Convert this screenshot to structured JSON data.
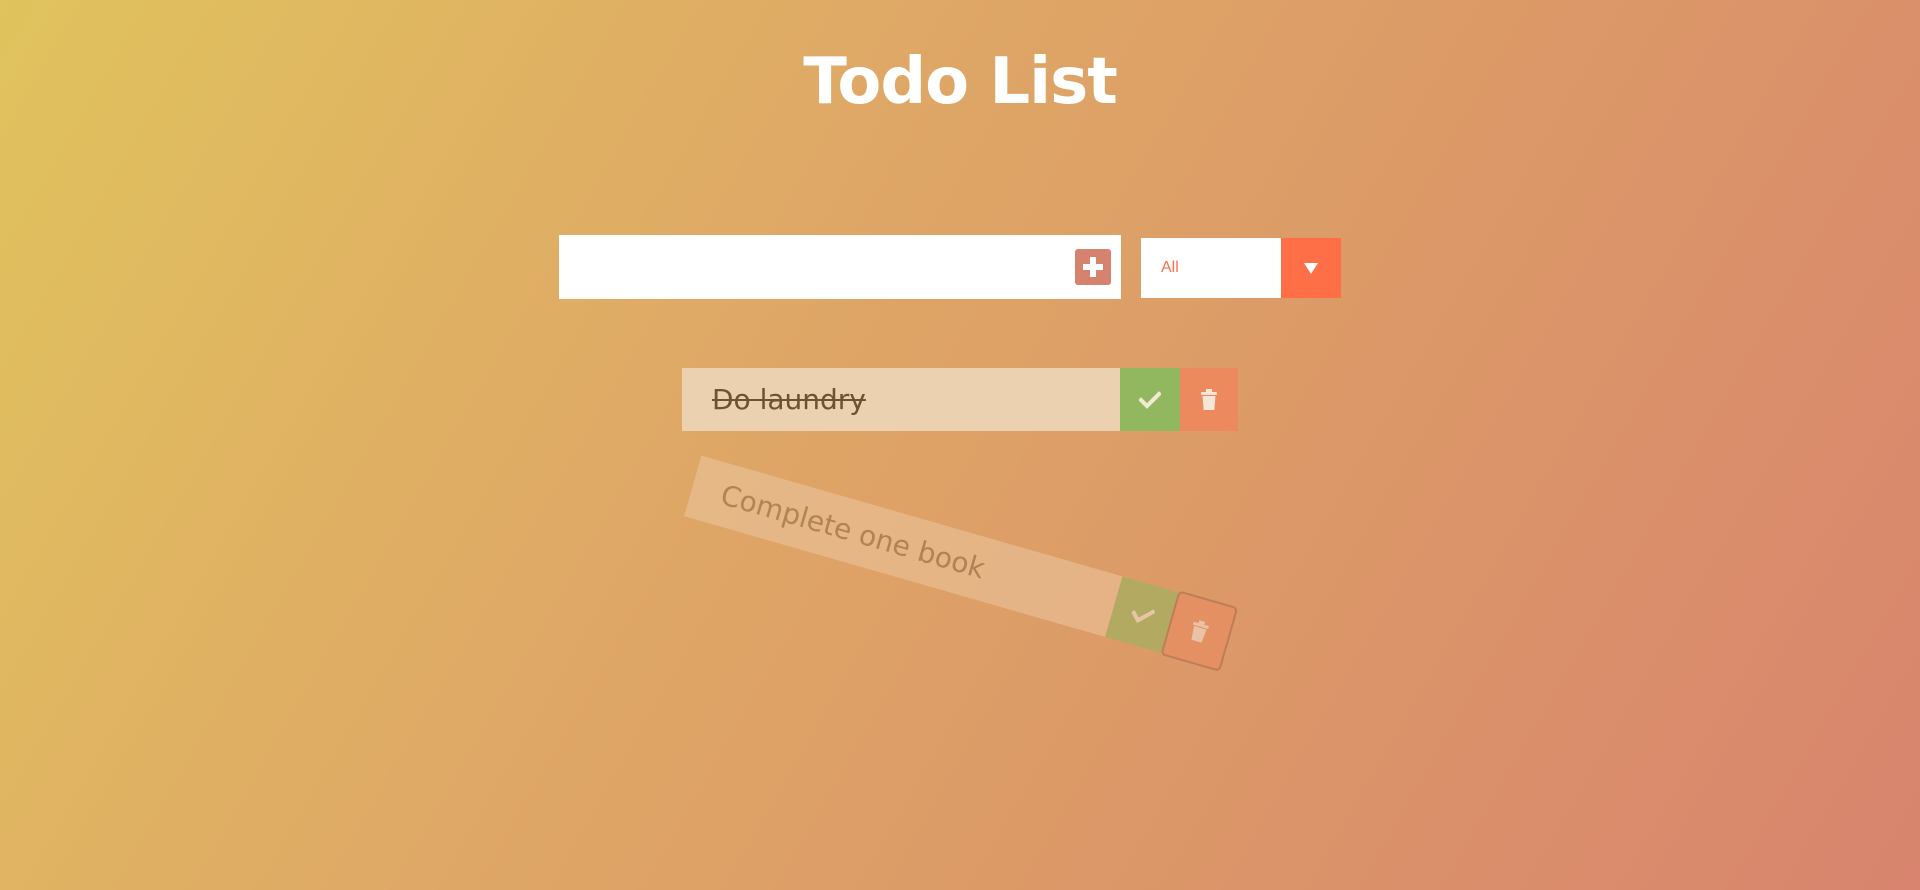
{
  "header": {
    "title": "Todo List"
  },
  "form": {
    "input_value": "",
    "input_placeholder": "",
    "add_icon": "plus-icon",
    "add_button_color": "#d5826f"
  },
  "filter": {
    "selected": "All",
    "arrow_icon": "triangle-down-icon",
    "accent_color": "#ff6f47"
  },
  "todos": [
    {
      "text": "Do laundry",
      "completed": true,
      "check_icon": "check-icon",
      "trash_icon": "trash-icon"
    },
    {
      "text": "Complete one book",
      "completed": false,
      "state": "being-deleted",
      "check_icon": "check-icon",
      "trash_icon": "trash-icon"
    }
  ],
  "colors": {
    "complete_button": "#92b85f",
    "trash_button": "#ec8a5e",
    "item_background": "#ecd1b1"
  }
}
